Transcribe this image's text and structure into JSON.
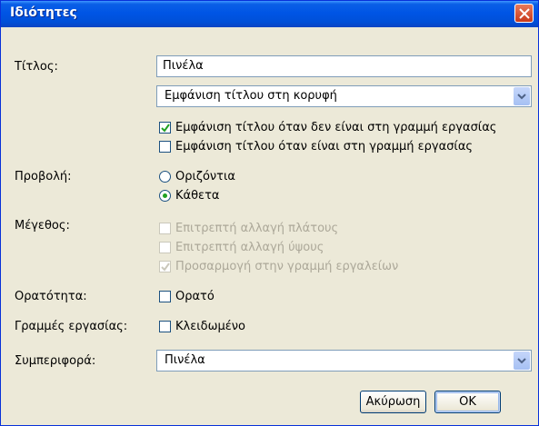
{
  "window": {
    "title": "Ιδιότητες"
  },
  "labels": {
    "title": "Τίτλος:",
    "view": "Προβολή:",
    "size": "Μέγεθος:",
    "visibility": "Ορατότητα:",
    "taskbars": "Γραμμές εργασίας:",
    "behavior": "Συμπεριφορά:"
  },
  "title_input": {
    "value": "Πινέλα"
  },
  "title_position_select": {
    "value": "Εμφάνιση τίτλου στη κορυφή"
  },
  "title_options": [
    {
      "label": "Εμφάνιση τίτλου όταν δεν είναι στη γραμμή εργασίας",
      "checked": true,
      "enabled": true
    },
    {
      "label": "Εμφάνιση τίτλου όταν είναι στη γραμμή εργασίας",
      "checked": false,
      "enabled": true
    }
  ],
  "view_options": [
    {
      "label": "Οριζόντια",
      "selected": false
    },
    {
      "label": "Κάθετα",
      "selected": true
    }
  ],
  "size_options": [
    {
      "label": "Επιτρεπτή αλλαγή πλάτους",
      "checked": false,
      "enabled": false
    },
    {
      "label": "Επιτρεπτή αλλαγή ύψους",
      "checked": false,
      "enabled": false
    },
    {
      "label": "Προσαρμογή στην γραμμή εργαλείων",
      "checked": true,
      "enabled": false
    }
  ],
  "visibility_option": {
    "label": "Ορατό",
    "checked": false
  },
  "taskbar_option": {
    "label": "Κλειδωμένο",
    "checked": false
  },
  "behavior_select": {
    "value": "Πινέλα"
  },
  "buttons": {
    "cancel": "Ακύρωση",
    "ok": "OK"
  }
}
